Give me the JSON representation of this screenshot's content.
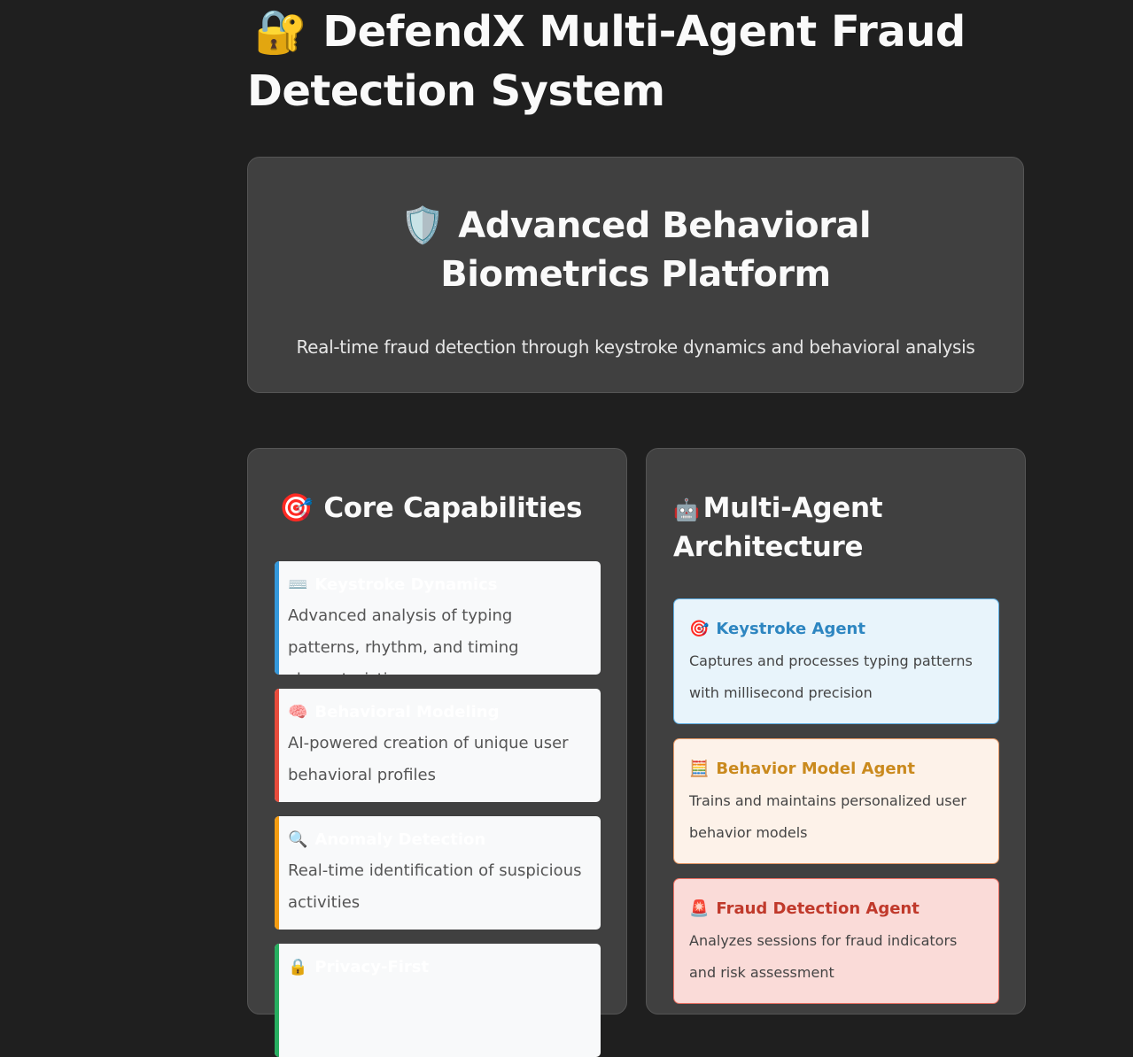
{
  "header": {
    "title_icon": "🔐",
    "title": "DefendX Multi-Agent Fraud Detection System"
  },
  "hero": {
    "icon": "🛡️",
    "heading": "Advanced Behavioral Biometrics Platform",
    "subtitle": "Real-time fraud detection through keystroke dynamics and behavioral analysis"
  },
  "capabilities": {
    "icon": "🎯",
    "heading": "Core Capabilities",
    "items": [
      {
        "icon": "⌨️",
        "title": "Keystroke Dynamics",
        "desc": "Advanced analysis of typing patterns, rhythm, and timing characteristics",
        "accent": "#3498db"
      },
      {
        "icon": "🧠",
        "title": "Behavioral Modeling",
        "desc": "AI-powered creation of unique user behavioral profiles",
        "accent": "#e74c3c"
      },
      {
        "icon": "🔍",
        "title": "Anomaly Detection",
        "desc": "Real-time identification of suspicious activities",
        "accent": "#f39c12"
      },
      {
        "icon": "🔒",
        "title": "Privacy-First",
        "desc": "",
        "accent": "#27ae60"
      }
    ]
  },
  "architecture": {
    "icon": "🤖",
    "heading": "Multi-Agent Architecture",
    "agents": [
      {
        "icon": "🎯",
        "title": "Keystroke Agent",
        "desc": "Captures and processes typing patterns with millisecond precision",
        "bg": "#e8f4fb",
        "border": "#5dade2",
        "color": "#2e86c1"
      },
      {
        "icon": "🧮",
        "title": "Behavior Model Agent",
        "desc": "Trains and maintains personalized user behavior models",
        "bg": "#fdf2e9",
        "border": "#e59866",
        "color": "#ca8a1e"
      },
      {
        "icon": "🚨",
        "title": "Fraud Detection Agent",
        "desc": "Analyzes sessions for fraud indicators and risk assessment",
        "bg": "#fadbd8",
        "border": "#ec7063",
        "color": "#c0392b"
      }
    ]
  }
}
